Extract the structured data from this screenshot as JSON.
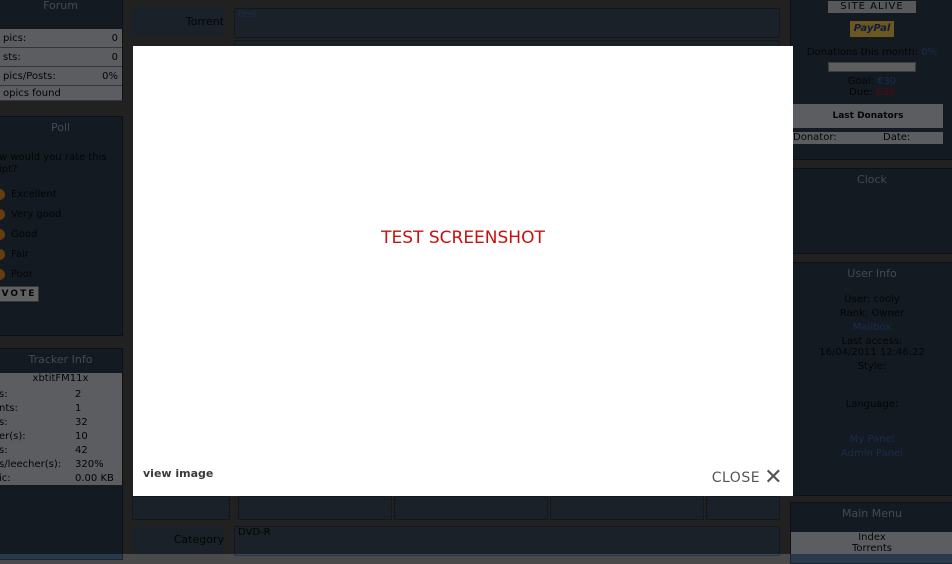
{
  "left": {
    "forum": {
      "title": "Forum",
      "rows": [
        {
          "label": "pics:",
          "value": "0"
        },
        {
          "label": "sts:",
          "value": "0"
        },
        {
          "label": "pics/Posts:",
          "value": "0%"
        }
      ],
      "footer": "opics found"
    },
    "poll": {
      "title": "Poll",
      "question": "w would you rate this ipt?",
      "options": [
        "Excellent",
        "Very good",
        "Good",
        "Fair",
        "Poor"
      ],
      "vote_label": "VOTE"
    },
    "tracker": {
      "title": "Tracker Info",
      "name": "xbtitFM11x",
      "rows": [
        {
          "label": "s:",
          "value": "2"
        },
        {
          "label": "nts:",
          "value": "1"
        },
        {
          "label": "s:",
          "value": "32"
        },
        {
          "label": "er(s):",
          "value": "10"
        },
        {
          "label": "s:",
          "value": "42"
        },
        {
          "label": "s/leecher(s):",
          "value": "320%"
        },
        {
          "label": "ic:",
          "value": "0.00 KB"
        }
      ]
    }
  },
  "middle": {
    "torrent_label": "Torrent",
    "torrent_value": "test",
    "hash_partial": "[obscured hash text]",
    "category_label": "Category",
    "category_value": "DVD-R"
  },
  "right": {
    "site_alive": "SITE ALIVE",
    "paypal": "PayPal",
    "donations_month": "Donations this month:",
    "donations_pct": "0%",
    "goal_label": "Goal:",
    "goal_value": "€30",
    "due_label": "Due:",
    "due_value": "€30",
    "last_donators": "Last Donators",
    "donator_col": "Donator:",
    "date_col": "Date:",
    "clock_title": "Clock",
    "userinfo": {
      "title": "User Info",
      "user": "User: cooly",
      "rank": "Rank: Owner",
      "mailbox": "Mailbox",
      "last_access_label": "Last access:",
      "last_access_value": "16/04/2011 12:46:22",
      "style": "Style:",
      "language": "Language:",
      "my_panel": "My Panel",
      "admin_panel": "Admin Panel"
    },
    "main_menu": {
      "title": "Main Menu",
      "items": [
        "Index",
        "Torrents"
      ]
    }
  },
  "modal": {
    "title": "TEST SCREENSHOT",
    "view_image": "view image",
    "close_label": "CLOSE"
  },
  "colors": {
    "modal_title": "#c81010",
    "panel_bg": "#2a3a4d",
    "overlay": "rgba(0,0,0,0.55)"
  }
}
